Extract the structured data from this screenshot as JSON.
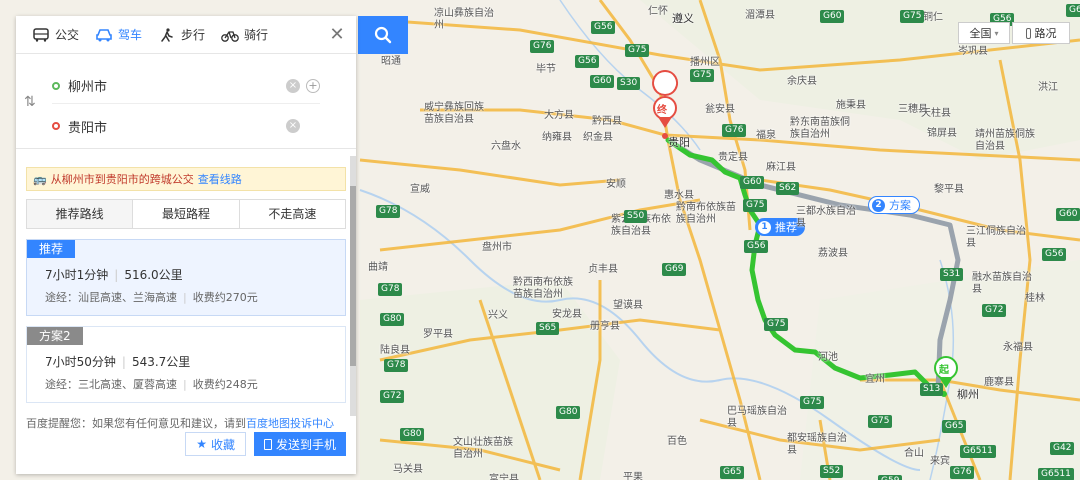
{
  "modes": [
    {
      "label": "公交",
      "icon": "bus-icon",
      "active": false
    },
    {
      "label": "驾车",
      "icon": "car-icon",
      "active": true
    },
    {
      "label": "步行",
      "icon": "walk-icon",
      "active": false
    },
    {
      "label": "骑行",
      "icon": "bike-icon",
      "active": false
    }
  ],
  "route": {
    "start": "柳州市",
    "end": "贵阳市"
  },
  "bus_tip": {
    "text": "从柳州市到贵阳市的跨城公交",
    "link": "查看线路"
  },
  "pref_tabs": [
    "推荐路线",
    "最短路程",
    "不走高速"
  ],
  "plans": [
    {
      "tag": "推荐",
      "time": "7小时1分钟",
      "distance": "516.0公里",
      "via": "途经：汕昆高速、兰海高速",
      "toll": "收费约270元"
    },
    {
      "tag": "方案2",
      "time": "7小时50分钟",
      "distance": "543.7公里",
      "via": "途经：三北高速、厦蓉高速",
      "toll": "收费约248元"
    }
  ],
  "feedback": {
    "prefix": "百度提醒您：如果您有任何意见和建议，请到",
    "link": "百度地图投诉中心"
  },
  "actions": {
    "fav": "收藏",
    "send": "发送到手机"
  },
  "controls": {
    "region": "全国",
    "traffic": "路况"
  },
  "map": {
    "markers": {
      "end": "终",
      "start": "起"
    },
    "route_tags": {
      "recommended": "推荐",
      "recommended_num": "1",
      "alt": "方案",
      "alt_num": "2"
    },
    "places": [
      {
        "t": "遵义",
        "big": true
      },
      {
        "t": "贵阳",
        "big": true
      },
      {
        "t": "柳州",
        "big": true
      },
      {
        "t": "凉山彝族自治州"
      },
      {
        "t": "仁怀"
      },
      {
        "t": "湄潭县"
      },
      {
        "t": "铜仁"
      },
      {
        "t": "昭通"
      },
      {
        "t": "毕节"
      },
      {
        "t": "播州区"
      },
      {
        "t": "余庆县"
      },
      {
        "t": "岑巩县"
      },
      {
        "t": "威宁彝族回族苗族自治县"
      },
      {
        "t": "大方县"
      },
      {
        "t": "黔西县"
      },
      {
        "t": "瓮安县"
      },
      {
        "t": "施秉县"
      },
      {
        "t": "三穗县"
      },
      {
        "t": "天柱县"
      },
      {
        "t": "洪江"
      },
      {
        "t": "纳雍县"
      },
      {
        "t": "织金县"
      },
      {
        "t": "贵定县"
      },
      {
        "t": "福泉"
      },
      {
        "t": "黔东南苗族侗族自治州"
      },
      {
        "t": "麻江县"
      },
      {
        "t": "锦屏县"
      },
      {
        "t": "靖州苗族侗族自治县"
      },
      {
        "t": "永胜县"
      },
      {
        "t": "六盘水"
      },
      {
        "t": "安顺"
      },
      {
        "t": "惠水县"
      },
      {
        "t": "黔南布依族苗族自治州"
      },
      {
        "t": "三都水族自治县"
      },
      {
        "t": "黎平县"
      },
      {
        "t": "宣威"
      },
      {
        "t": "紫云苗族布依族自治县"
      },
      {
        "t": "三江侗族自治县"
      },
      {
        "t": "盘州市"
      },
      {
        "t": "贞丰县"
      },
      {
        "t": "荔波县"
      },
      {
        "t": "黔西南布依族苗族自治州"
      },
      {
        "t": "曲靖"
      },
      {
        "t": "望谟县"
      },
      {
        "t": "融水苗族自治县"
      },
      {
        "t": "桂林"
      },
      {
        "t": "陆良县"
      },
      {
        "t": "兴义"
      },
      {
        "t": "安龙县"
      },
      {
        "t": "罗平县"
      },
      {
        "t": "册亨县"
      },
      {
        "t": "河池"
      },
      {
        "t": "宜州"
      },
      {
        "t": "永福县"
      },
      {
        "t": "鹿寨县"
      },
      {
        "t": "巴马瑶族自治县"
      },
      {
        "t": "文山壮族苗族自治州"
      },
      {
        "t": "都安瑶族自治县"
      },
      {
        "t": "百色"
      },
      {
        "t": "合山"
      },
      {
        "t": "来宾"
      },
      {
        "t": "马关县"
      },
      {
        "t": "富宁县"
      },
      {
        "t": "平果"
      },
      {
        "t": "蒙自"
      }
    ],
    "roads": [
      "G85",
      "G56",
      "G76",
      "G75",
      "G56",
      "G60",
      "S30",
      "G75",
      "G60",
      "G75",
      "G56",
      "G60",
      "G76",
      "S62",
      "G60",
      "G75",
      "G56",
      "G78",
      "S50",
      "G60",
      "G56",
      "G69",
      "S65",
      "G78",
      "G80",
      "G75",
      "G78",
      "G75",
      "G80",
      "S13",
      "G65",
      "G6511",
      "G72",
      "G75",
      "G6511",
      "S31",
      "G72",
      "G80",
      "S52",
      "G65",
      "G59",
      "G76",
      "G42"
    ]
  }
}
